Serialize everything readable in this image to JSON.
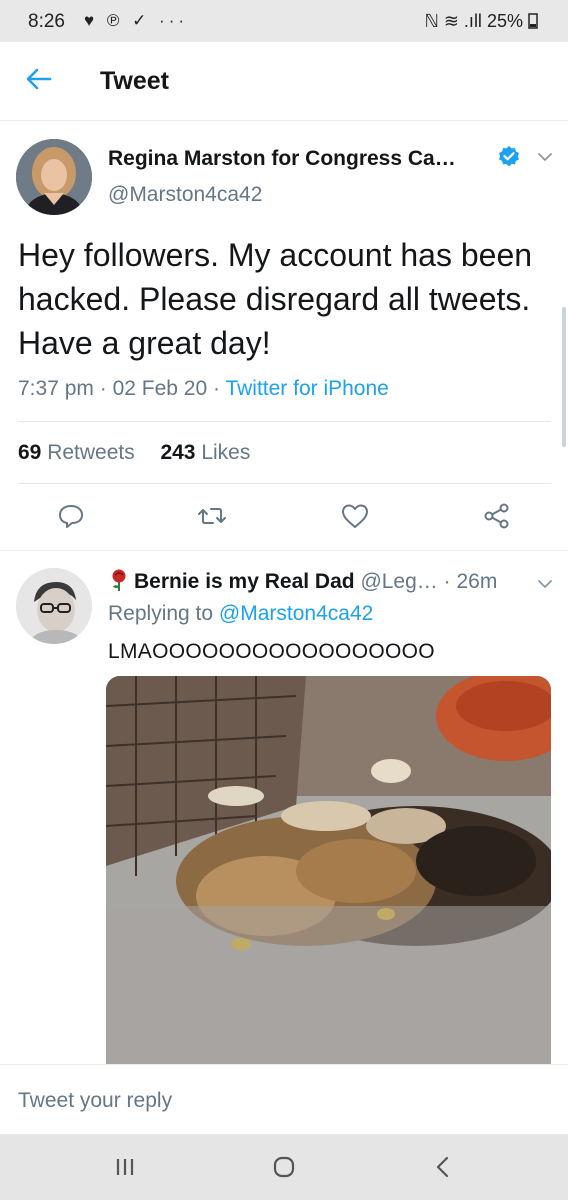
{
  "status_bar": {
    "time": "8:26",
    "notification_icons": "♥ ℗ ✓ ···",
    "indicators": "ℕ ≋ .ıll",
    "battery": "25%"
  },
  "header": {
    "title": "Tweet"
  },
  "tweet": {
    "display_name": "Regina Marston for Congress Ca…",
    "handle": "@Marston4ca42",
    "verified": true,
    "text": "Hey followers. My account has been hacked. Please disregard all tweets. Have a great day!",
    "time": "7:37 pm",
    "date": "02 Feb 20",
    "source": "Twitter for iPhone",
    "retweets_count": "69",
    "retweets_label": "Retweets",
    "likes_count": "243",
    "likes_label": "Likes"
  },
  "reply": {
    "display_name": "Bernie is my Real Dad",
    "handle": "@Leg…",
    "age": "26m",
    "replying_prefix": "Replying to",
    "replying_to": "@Marston4ca42",
    "text": "LMAOOOOOOOOOOOOOOOOO"
  },
  "composer": {
    "placeholder": "Tweet your reply"
  },
  "colors": {
    "accent": "#1da1f2",
    "secondary_text": "#657786",
    "text": "#14171a"
  },
  "icons": [
    "back-arrow-icon",
    "verified-badge-icon",
    "chevron-down-icon",
    "reply-icon",
    "retweet-icon",
    "like-icon",
    "share-icon",
    "rose-icon",
    "recents-icon",
    "home-icon",
    "back-nav-icon"
  ]
}
